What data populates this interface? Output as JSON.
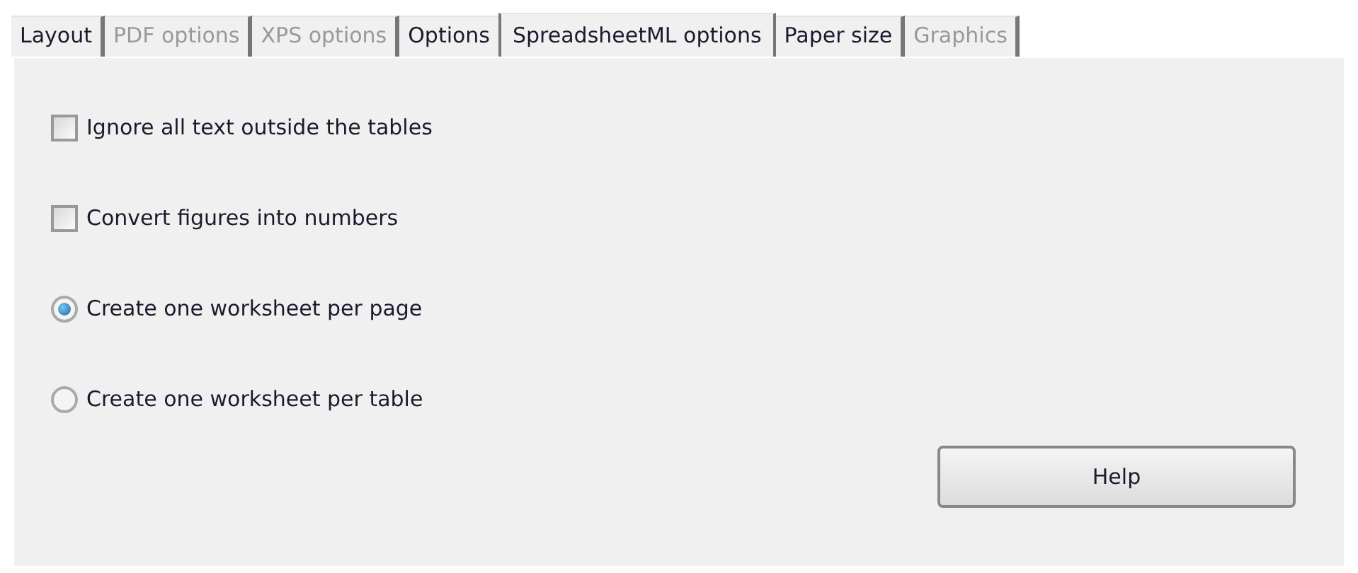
{
  "tabs": [
    {
      "label": "Layout",
      "selected": false,
      "disabled": false
    },
    {
      "label": "PDF options",
      "selected": false,
      "disabled": true
    },
    {
      "label": "XPS options",
      "selected": false,
      "disabled": true
    },
    {
      "label": "Options",
      "selected": false,
      "disabled": false
    },
    {
      "label": "SpreadsheetML options",
      "selected": true,
      "disabled": false
    },
    {
      "label": "Paper size",
      "selected": false,
      "disabled": false
    },
    {
      "label": "Graphics",
      "selected": false,
      "disabled": true
    }
  ],
  "options": [
    {
      "kind": "checkbox",
      "label": "Ignore all text outside the tables",
      "checked": false
    },
    {
      "kind": "checkbox",
      "label": "Convert figures into numbers",
      "checked": false
    },
    {
      "kind": "radio",
      "label": "Create one worksheet per page",
      "selected": true
    },
    {
      "kind": "radio",
      "label": "Create one worksheet per table",
      "selected": false
    }
  ],
  "buttons": [
    "Help"
  ]
}
